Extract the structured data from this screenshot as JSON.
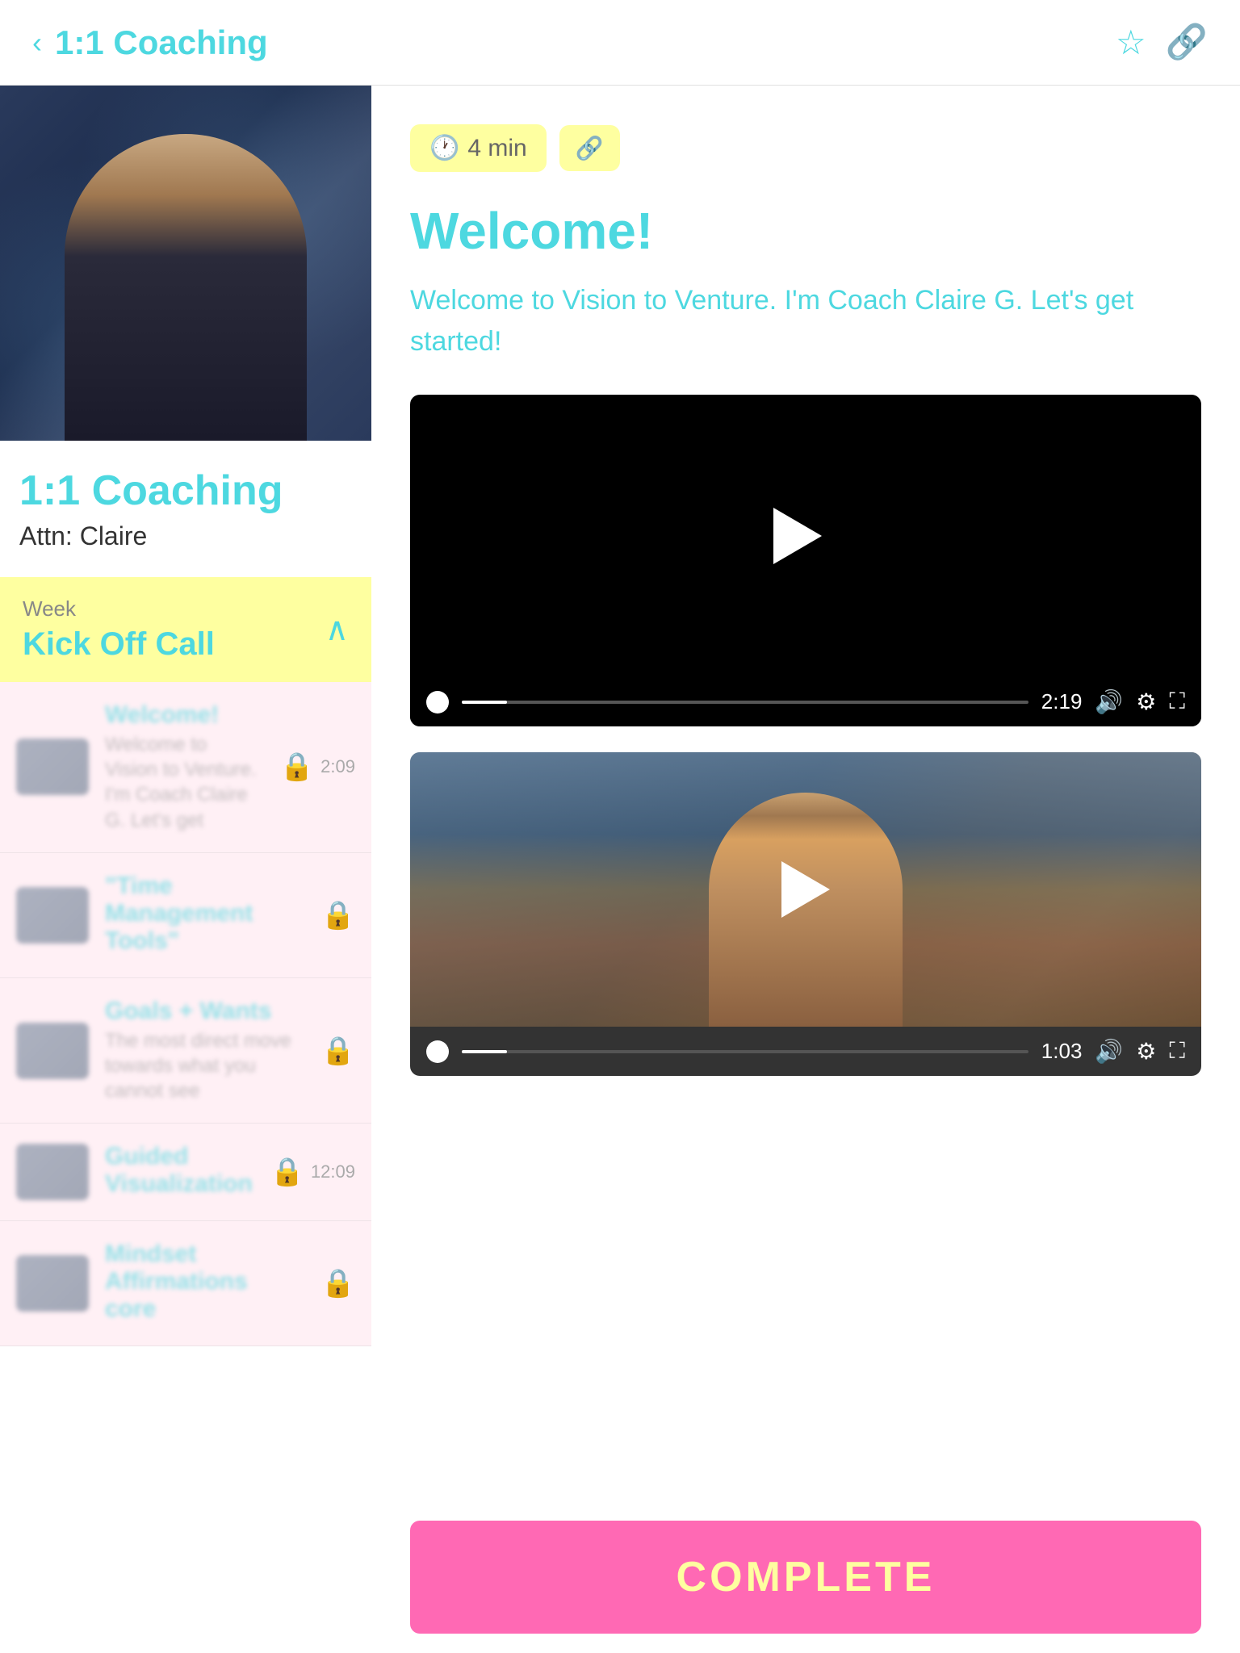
{
  "header": {
    "back_label": "‹",
    "title": "1:1 Coaching",
    "bookmark_icon": "☆",
    "link_icon": "🔗"
  },
  "left": {
    "course_title": "1:1 Coaching",
    "course_subtitle": "Attn: Claire",
    "week": {
      "label": "Week",
      "name": "Kick Off Call"
    },
    "lessons": [
      {
        "title": "Welcome!",
        "desc": "Welcome to Vision to Venture. I'm Coach Claire G. Let's get",
        "duration": "2:09",
        "locked": true,
        "active": true
      },
      {
        "title": "\"Time Management Tools\"",
        "desc": "",
        "duration": "",
        "locked": true
      },
      {
        "title": "Goals + Wants",
        "desc": "The most direct move towards what you cannot see",
        "duration": "",
        "locked": true
      },
      {
        "title": "Guided Visualization",
        "desc": "",
        "duration": "12:09",
        "locked": true
      },
      {
        "title": "Mindset Affirmations core",
        "desc": "",
        "duration": "",
        "locked": true
      }
    ]
  },
  "right": {
    "duration_tag": "4 min",
    "duration_icon": "🕐",
    "link_icon": "🔗",
    "title": "Welcome!",
    "description": "Welcome to Vision to Venture. I'm Coach Claire G. Let's get started!",
    "video1": {
      "time": "2:19"
    },
    "video2": {
      "time": "1:03"
    },
    "complete_button": "COMPLETE"
  }
}
